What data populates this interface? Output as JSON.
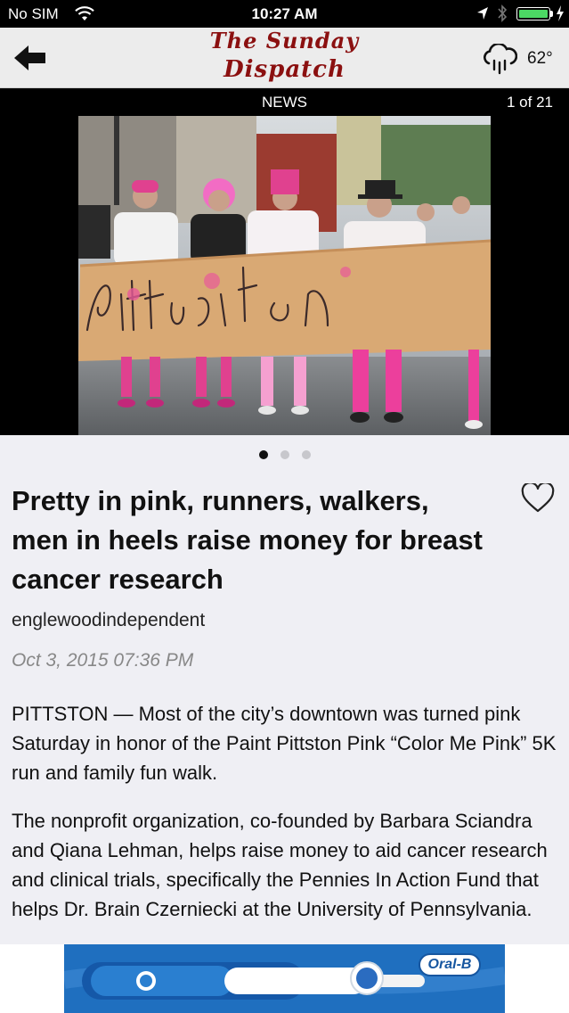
{
  "status_bar": {
    "carrier": "No SIM",
    "time": "10:27 AM",
    "battery_level": 1.0,
    "battery_color": "#4cd964"
  },
  "nav": {
    "back_icon": "back-arrow-icon",
    "logo_line1": "The Sunday",
    "logo_line2": "Dispatch",
    "logo_color": "#8b1010",
    "weather_icon": "rain-cloud-icon",
    "temperature": "62°"
  },
  "section_bar": {
    "section": "NEWS",
    "counter": "1 of 21"
  },
  "photo": {
    "banner_text": "Pittston",
    "page_index": 0,
    "page_count": 3
  },
  "article": {
    "headline": "Pretty in pink, runners, walkers, men in heels raise money for breast cancer research",
    "favorite_icon": "heart-icon",
    "source": "englewoodindependent",
    "date": "Oct 3, 2015 07:36 PM",
    "paragraphs": [
      "PITTSTON — Most of the city’s downtown was turned pink Saturday in honor of the Paint Pittston Pink “Color Me Pink” 5K run and family fun walk.",
      "The nonprofit organization, co-founded by Barbara Sciandra and Qiana Lehman, helps raise money to aid cancer research and clinical trials, specifically the Pennies In Action Fund that helps Dr. Brain Czerniecki at the University of Pennsylvania."
    ]
  },
  "ad": {
    "brand": "Oral-B",
    "background": "#1f6fbf"
  }
}
